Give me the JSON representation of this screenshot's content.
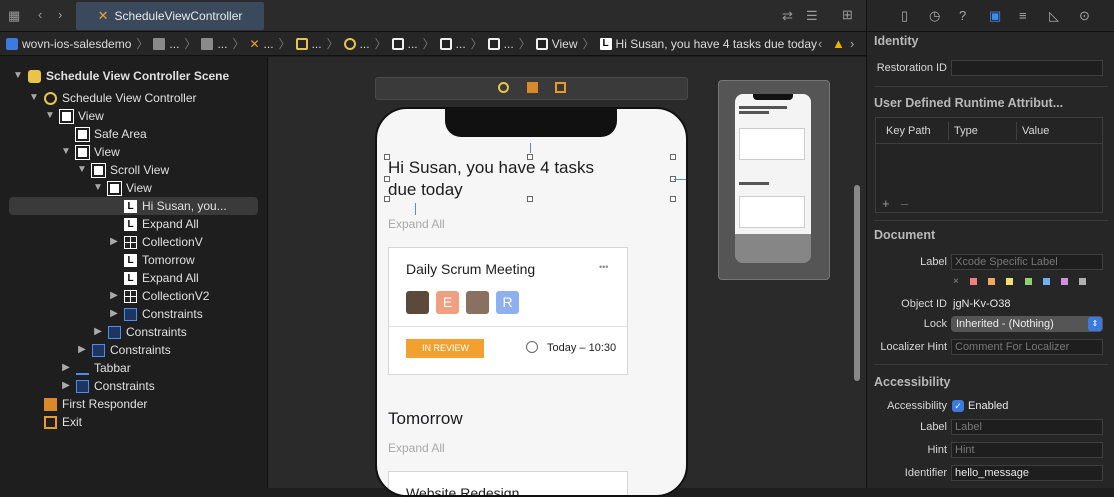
{
  "toolbar": {
    "tab_title": "ScheduleViewController"
  },
  "breadcrumb": {
    "project": "wovn-ios-salesdemo",
    "ellipsis": "...",
    "last_view": "View",
    "label": "Hi Susan, you have 4 tasks due today"
  },
  "outline": {
    "items": [
      {
        "label": "Schedule View Controller Scene"
      },
      {
        "label": "Schedule View Controller"
      },
      {
        "label": "View"
      },
      {
        "label": "Safe Area"
      },
      {
        "label": "View"
      },
      {
        "label": "Scroll View"
      },
      {
        "label": "View"
      },
      {
        "label": "Hi Susan, you..."
      },
      {
        "label": "Expand All"
      },
      {
        "label": "CollectionV"
      },
      {
        "label": "Tomorrow"
      },
      {
        "label": "Expand All"
      },
      {
        "label": "CollectionV2"
      },
      {
        "label": "Constraints"
      },
      {
        "label": "Constraints"
      },
      {
        "label": "Constraints"
      },
      {
        "label": "Tabbar"
      },
      {
        "label": "Constraints"
      },
      {
        "label": "First Responder"
      },
      {
        "label": "Exit"
      }
    ]
  },
  "phone": {
    "greeting": "Hi Susan, you have 4 tasks due today",
    "expand_all_1": "Expand All",
    "card_title": "Daily Scrum Meeting",
    "more": "•••",
    "avatar_e": "E",
    "avatar_r": "R",
    "status": "IN REVIEW",
    "time": "Today – 10:30",
    "tomorrow": "Tomorrow",
    "expand_all_2": "Expand All",
    "card2_title": "Website Redesign"
  },
  "inspector": {
    "identity": {
      "title": "Identity",
      "restoration_id_label": "Restoration ID",
      "restoration_id_value": ""
    },
    "runtime_attrs": {
      "title": "User Defined Runtime Attribut...",
      "columns": [
        "Key Path",
        "Type",
        "Value"
      ],
      "add": "+",
      "remove": "–"
    },
    "document": {
      "title": "Document",
      "label_label": "Label",
      "label_placeholder": "Xcode Specific Label",
      "clear": "×",
      "object_id_label": "Object ID",
      "object_id_value": "jgN-Kv-O38",
      "lock_label": "Lock",
      "lock_value": "Inherited - (Nothing)",
      "localizer_label": "Localizer Hint",
      "localizer_placeholder": "Comment For Localizer",
      "swatches": [
        "#f08080",
        "#f0a860",
        "#f0e070",
        "#90d070",
        "#70b0f0",
        "#d090e0",
        "#b0b0b0"
      ]
    },
    "accessibility": {
      "title": "Accessibility",
      "accessibility_label": "Accessibility",
      "enabled_label": "Enabled",
      "label_label": "Label",
      "label_placeholder": "Label",
      "hint_label": "Hint",
      "hint_placeholder": "Hint",
      "identifier_label": "Identifier",
      "identifier_value": "hello_message"
    }
  }
}
